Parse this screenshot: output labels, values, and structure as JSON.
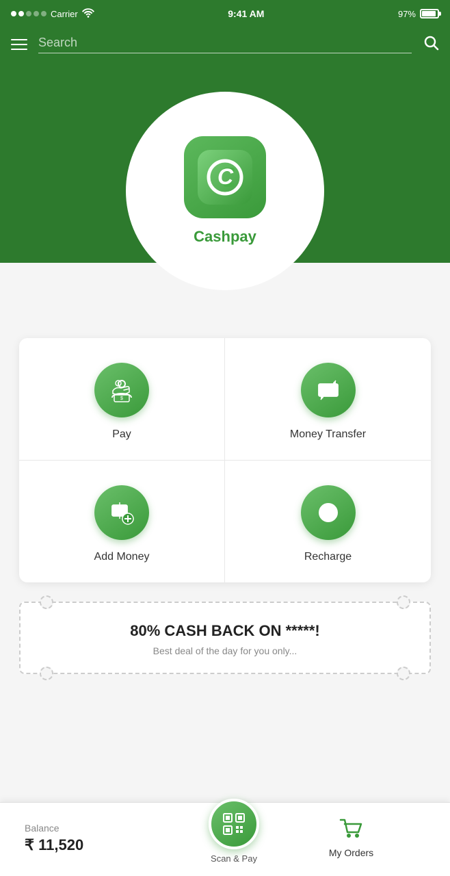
{
  "statusBar": {
    "carrier": "Carrier",
    "time": "9:41 AM",
    "battery": "97%"
  },
  "searchBar": {
    "placeholder": "Search"
  },
  "hero": {
    "appName": "Cashpay"
  },
  "actions": [
    {
      "id": "pay",
      "label": "Pay",
      "icon": "pay"
    },
    {
      "id": "money-transfer",
      "label": "Money Transfer",
      "icon": "money-transfer"
    },
    {
      "id": "add-money",
      "label": "Add Money",
      "icon": "add-money"
    },
    {
      "id": "recharge",
      "label": "Recharge",
      "icon": "recharge"
    }
  ],
  "promo": {
    "title": "80% CASH BACK ON *****!",
    "subtitle": "Best deal of the day for you only..."
  },
  "bottomBar": {
    "balanceLabel": "Balance",
    "balanceAmount": "₹ 11,520",
    "scanLabel": "Scan & Pay",
    "ordersLabel": "My Orders"
  }
}
